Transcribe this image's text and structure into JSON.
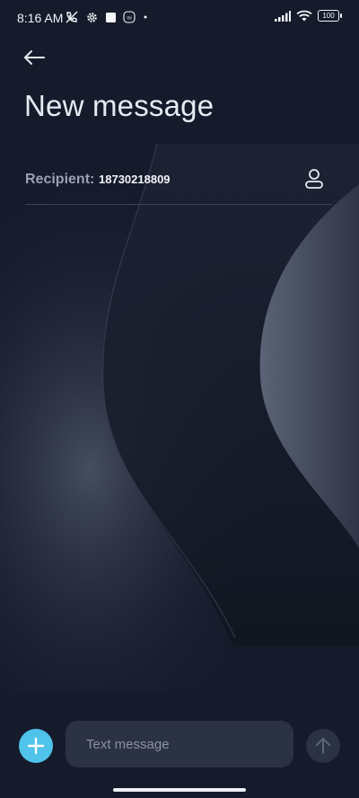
{
  "status_bar": {
    "time": "8:16 AM",
    "left_icons": [
      "no-call-icon",
      "settings-gear-icon",
      "square-icon",
      "mi-icon",
      "dot-icon"
    ],
    "right_icons": [
      "signal-icon",
      "wifi-icon",
      "battery-icon"
    ],
    "battery_level": "100"
  },
  "header": {
    "back_icon": "arrow-left-icon",
    "title": "New message"
  },
  "recipient": {
    "label": "Recipient:",
    "value": "18730218809",
    "picker_icon": "person-icon"
  },
  "composer": {
    "attach_icon": "plus-icon",
    "placeholder": "Text message",
    "send_icon": "arrow-up-icon"
  },
  "colors": {
    "background": "#151b2b",
    "accent": "#4fc3ea",
    "input_background": "#2b3243",
    "label": "#9aa2b3"
  }
}
